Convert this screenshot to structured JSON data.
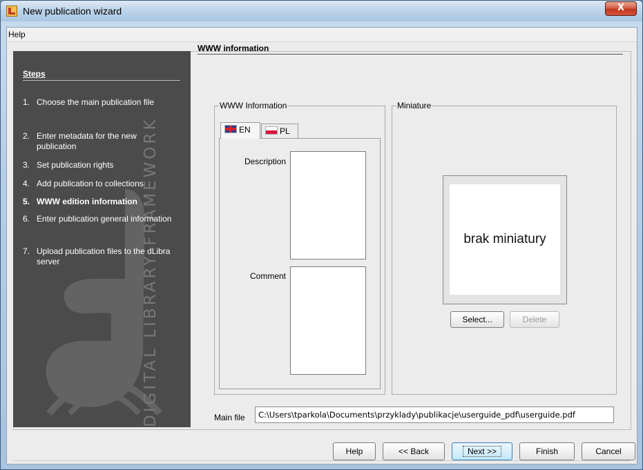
{
  "window": {
    "title": "New publication wizard",
    "close_label": "X"
  },
  "menu": {
    "help": "Help"
  },
  "steps": {
    "title": "Steps",
    "watermark_text": "DIGITAL LIBRARY FRAMEWORK",
    "items": [
      {
        "num": "1.",
        "label": "Choose the main publication file"
      },
      {
        "num": "2.",
        "label": "Enter metadata for the new publication"
      },
      {
        "num": "3.",
        "label": "Set publication rights"
      },
      {
        "num": "4.",
        "label": "Add publication to collections"
      },
      {
        "num": "5.",
        "label": "WWW edition information"
      },
      {
        "num": "6.",
        "label": "Enter publication general information"
      },
      {
        "num": "7.",
        "label": "Upload publication files to the dLibra server"
      }
    ]
  },
  "content": {
    "title": "WWW information",
    "www_group": {
      "legend": "WWW Information",
      "tabs": [
        {
          "label": "EN"
        },
        {
          "label": "PL"
        }
      ],
      "description_label": "Description",
      "comment_label": "Comment"
    },
    "miniature_group": {
      "legend": "Miniature",
      "placeholder": "brak miniatury",
      "select_label": "Select...",
      "delete_label": "Delete"
    },
    "main_file": {
      "label": "Main file",
      "value": "C:\\Users\\tparkola\\Documents\\przyklady\\publikacje\\userguide_pdf\\userguide.pdf"
    }
  },
  "buttons": {
    "help": "Help",
    "back": "<< Back",
    "next": "Next >>",
    "finish": "Finish",
    "cancel": "Cancel"
  }
}
